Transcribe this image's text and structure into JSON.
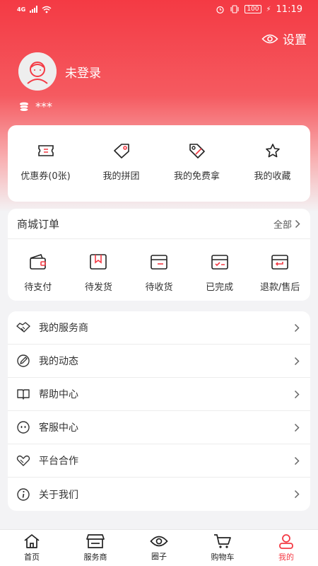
{
  "status": {
    "network": "4G",
    "battery": "100",
    "time": "11:19"
  },
  "header": {
    "settings_label": "设置",
    "username": "未登录",
    "points": "***"
  },
  "quick": [
    {
      "label": "优惠券(0张)",
      "icon": "coupon-icon"
    },
    {
      "label": "我的拼团",
      "icon": "tag-icon"
    },
    {
      "label": "我的免费拿",
      "icon": "free-tag-icon"
    },
    {
      "label": "我的收藏",
      "icon": "star-icon"
    }
  ],
  "orders": {
    "title": "商城订单",
    "all_label": "全部",
    "items": [
      {
        "label": "待支付",
        "icon": "wallet-icon"
      },
      {
        "label": "待发货",
        "icon": "package-icon"
      },
      {
        "label": "待收货",
        "icon": "box-icon"
      },
      {
        "label": "已完成",
        "icon": "box-check-icon"
      },
      {
        "label": "退款/售后",
        "icon": "box-return-icon"
      }
    ]
  },
  "menu": [
    {
      "label": "我的服务商",
      "icon": "handshake-icon"
    },
    {
      "label": "我的动态",
      "icon": "pen-icon"
    },
    {
      "label": "帮助中心",
      "icon": "book-icon"
    },
    {
      "label": "客服中心",
      "icon": "chat-icon"
    },
    {
      "label": "平台合作",
      "icon": "partner-heart-icon"
    },
    {
      "label": "关于我们",
      "icon": "info-icon"
    }
  ],
  "tabs": [
    {
      "label": "首页",
      "icon": "home-icon"
    },
    {
      "label": "服务商",
      "icon": "store-icon"
    },
    {
      "label": "圈子",
      "icon": "eye-icon"
    },
    {
      "label": "购物车",
      "icon": "cart-icon"
    },
    {
      "label": "我的",
      "icon": "profile-icon"
    }
  ],
  "colors": {
    "accent": "#f43a44",
    "background": "#f3f3f5"
  }
}
